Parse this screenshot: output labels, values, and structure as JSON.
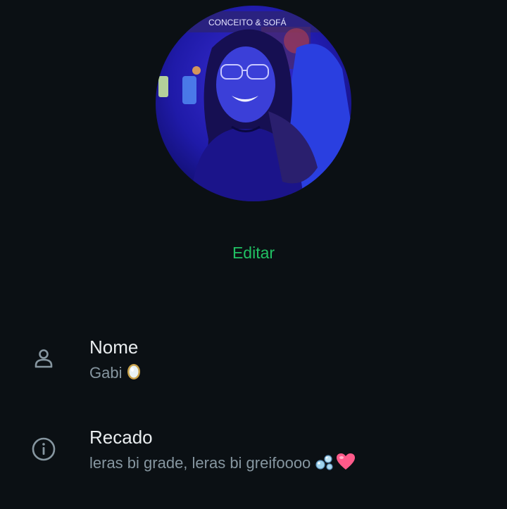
{
  "profile": {
    "photo_text": "CONCEITO & SOFÁ",
    "edit_label": "Editar"
  },
  "name_row": {
    "icon": "person-icon",
    "label": "Nome",
    "value": "Gabi",
    "value_emoji": "mirror-emoji"
  },
  "about_row": {
    "icon": "info-icon",
    "label": "Recado",
    "value": "leras bi grade, leras bi greifoooo",
    "value_emojis": [
      "bubbles-emoji",
      "pink-heart-emoji"
    ]
  },
  "colors": {
    "background": "#0b1014",
    "accent": "#21c063",
    "primary_text": "#e9edef",
    "secondary_text": "#8696a0",
    "icon": "#8696a0"
  }
}
